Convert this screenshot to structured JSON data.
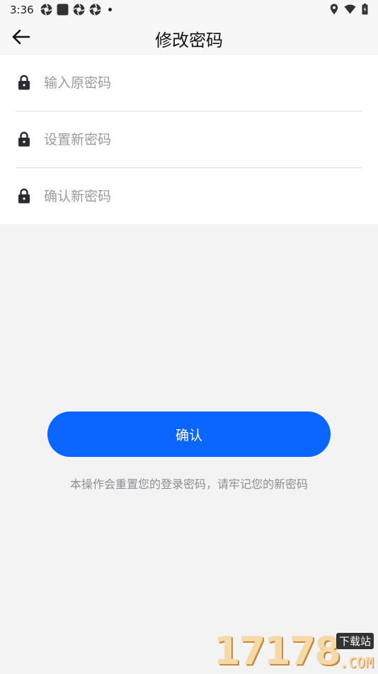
{
  "status_bar": {
    "time": "3:36",
    "icons_left": [
      "aperture-icon",
      "square-icon",
      "aperture-icon",
      "aperture-icon",
      "dot-icon"
    ],
    "icons_right": [
      "location-icon",
      "wifi-icon",
      "battery-icon"
    ]
  },
  "header": {
    "back_icon": "arrow-left-icon",
    "title": "修改密码"
  },
  "form": {
    "fields": [
      {
        "placeholder": "输入原密码",
        "icon": "lock-icon"
      },
      {
        "placeholder": "设置新密码",
        "icon": "lock-icon"
      },
      {
        "placeholder": "确认新密码",
        "icon": "lock-icon"
      }
    ]
  },
  "confirm_label": "确认",
  "notice": "本操作会重置您的登录密码，请牢记您的新密码",
  "watermark": {
    "number": "17178",
    "tag": "下载站",
    "domain": ".COM"
  },
  "colors": {
    "accent": "#0a66ff",
    "page_background": "#f3f3f4",
    "placeholder": "#9a9aa2"
  }
}
